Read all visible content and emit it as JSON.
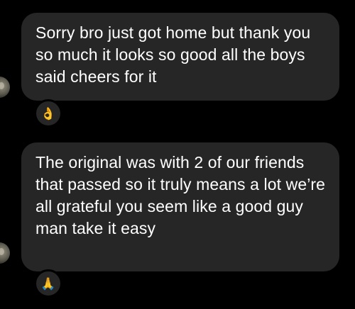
{
  "messages": [
    {
      "text": "Sorry bro just got home but thank you so much it looks so good all the boys said cheers for it",
      "reaction": "👌"
    },
    {
      "text": "The original was with 2 of our friends that passed so it truly means a lot we’re all grateful you seem like a good guy man take it easy",
      "reaction": "🙏"
    }
  ],
  "colors": {
    "background": "#000000",
    "bubble": "#262626",
    "text": "#ffffff"
  }
}
